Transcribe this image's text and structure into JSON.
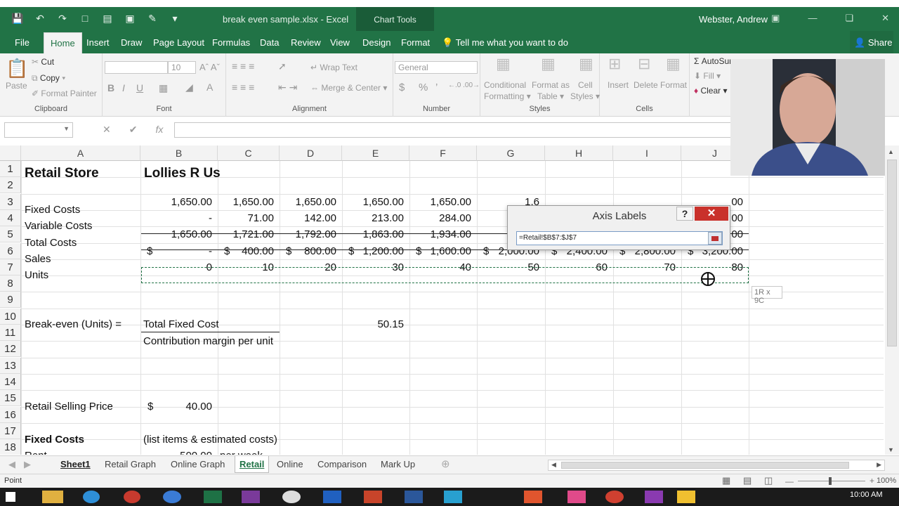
{
  "window": {
    "title": "break even sample.xlsx - Excel",
    "chart_tools": "Chart Tools",
    "user": "Webster, Andrew"
  },
  "tabs": [
    {
      "label": "File"
    },
    {
      "label": "Home"
    },
    {
      "label": "Insert"
    },
    {
      "label": "Draw"
    },
    {
      "label": "Page Layout"
    },
    {
      "label": "Formulas"
    },
    {
      "label": "Data"
    },
    {
      "label": "Review"
    },
    {
      "label": "View"
    },
    {
      "label": "Design"
    },
    {
      "label": "Format"
    }
  ],
  "tellme": "Tell me what you want to do",
  "share": "Share",
  "ribbon": {
    "clipboard": {
      "label": "Clipboard",
      "paste": "Paste",
      "cut": "Cut",
      "copy": "Copy",
      "format_painter": "Format Painter"
    },
    "font": {
      "label": "Font",
      "size": "10"
    },
    "alignment": {
      "label": "Alignment",
      "wrap_text": "Wrap Text",
      "merge_center": "Merge & Center"
    },
    "number": {
      "label": "Number",
      "format": "General",
      "dollar": "$",
      "percent": "%",
      "comma": "’"
    },
    "styles": {
      "label": "Styles",
      "conditional": "Conditional",
      "formatting": "Formatting",
      "format_as": "Format as",
      "table": "Table",
      "cell": "Cell",
      "styles": "Styles"
    },
    "cells": {
      "label": "Cells",
      "insert": "Insert",
      "delete": "Delete",
      "format": "Format"
    },
    "editing": {
      "autosum": "AutoSum",
      "fill": "Fill",
      "clear": "Clear"
    }
  },
  "formula_bar": {
    "fx": "fx",
    "cancel": "✕",
    "enter": "✔"
  },
  "columns": [
    "A",
    "B",
    "C",
    "D",
    "E",
    "F",
    "G",
    "H",
    "I",
    "J"
  ],
  "rows": [
    "1",
    "2",
    "3",
    "4",
    "5",
    "6",
    "7",
    "8",
    "9",
    "10",
    "11",
    "12",
    "13",
    "14",
    "15",
    "16",
    "17",
    "18"
  ],
  "cells": {
    "A1": "Retail Store",
    "B1": "Lollies R Us",
    "A3": "Fixed Costs",
    "A4": "Variable Costs",
    "A5": "Total Costs",
    "A6": "Sales",
    "A7": "Units",
    "A10": "Break-even (Units) =",
    "B10": "Total Fixed Cost",
    "E10": "50.15",
    "B11": "Contribution margin per unit",
    "A15": "Retail Selling Price",
    "B15_sym": "$",
    "B15": "40.00",
    "A17": "Fixed Costs",
    "B17": "(list items & estimated costs)",
    "A18": "Rent",
    "B18": "500.00",
    "C18": "per week"
  },
  "row_fixed": [
    "1,650.00",
    "1,650.00",
    "1,650.00",
    "1,650.00",
    "1,650.00",
    "1,6",
    "",
    "",
    "00"
  ],
  "row_variable": [
    "-",
    "71.00",
    "142.00",
    "213.00",
    "284.00",
    "",
    "",
    "",
    "00"
  ],
  "row_total": [
    "1,650.00",
    "1,721.00",
    "1,792.00",
    "1,863.00",
    "1,934.00",
    "2,0",
    "",
    "",
    "00"
  ],
  "row_sales": [
    "-",
    "400.00",
    "800.00",
    "1,200.00",
    "1,600.00",
    "2,000.00",
    "2,400.00",
    "2,800.00",
    "3,200.00"
  ],
  "row_units": [
    "0",
    "10",
    "20",
    "30",
    "40",
    "50",
    "60",
    "70",
    "80"
  ],
  "currency": "$",
  "size_hint": "1R x 9C",
  "dialog": {
    "title": "Axis Labels",
    "help": "?",
    "close": "✕",
    "range_value": "=Retail!$B$7:$J$7"
  },
  "sheet_tabs": [
    {
      "label": "Sheet1"
    },
    {
      "label": "Retail Graph"
    },
    {
      "label": "Online Graph"
    },
    {
      "label": "Retail"
    },
    {
      "label": "Online"
    },
    {
      "label": "Comparison"
    },
    {
      "label": "Mark Up"
    }
  ],
  "status": {
    "mode": "Point",
    "zoom": "100%",
    "clock": "10:00 AM"
  }
}
